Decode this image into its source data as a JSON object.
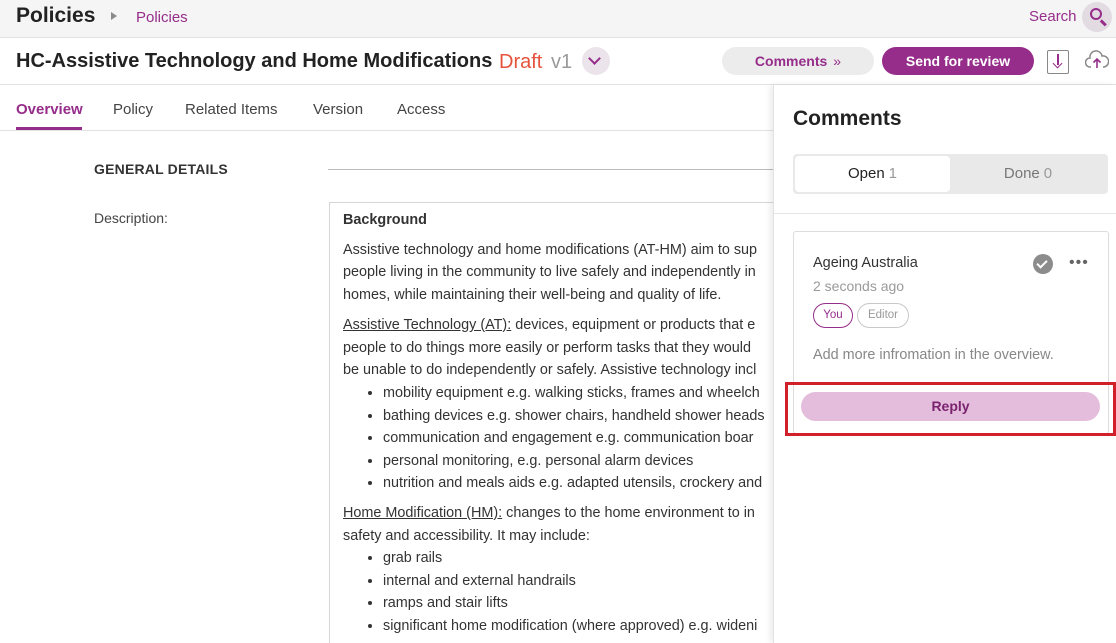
{
  "topbar": {
    "app_title": "Policies",
    "breadcrumb": "Policies",
    "search_label": "Search"
  },
  "header": {
    "doc_title": "HC-Assistive Technology and Home Modifications",
    "status": "Draft",
    "version": "v1",
    "comments_button": "Comments",
    "comments_chevrons": "»",
    "send_button": "Send for review"
  },
  "tabs": [
    "Overview",
    "Policy",
    "Related Items",
    "Version",
    "Access"
  ],
  "general": {
    "section_title": "GENERAL DETAILS",
    "description_label": "Description:"
  },
  "description": {
    "heading": "Background",
    "para1": [
      "Assistive technology and home modifications (AT-HM) aim to sup",
      "people living in the community to live safely and independently in",
      "homes, while maintaining their well-being and quality of life."
    ],
    "at_term": "Assistive Technology (AT):",
    "at_text": [
      " devices, equipment or products that e",
      "people to do things more easily or perform tasks that they would",
      "be unable to do independently or safely. Assistive technology incl"
    ],
    "at_items": [
      "mobility equipment e.g. walking sticks, frames and wheelch",
      "bathing devices e.g. shower chairs, handheld shower heads",
      "communication and engagement e.g. communication boar",
      "personal monitoring, e.g. personal alarm devices",
      "nutrition and meals aids e.g. adapted utensils, crockery and"
    ],
    "hm_term": "Home Modification (HM):",
    "hm_text": [
      " changes to the home environment to in",
      "safety and accessibility. It may include:"
    ],
    "hm_items": [
      "grab rails",
      "internal and external handrails",
      "ramps and stair lifts",
      "significant home modification (where approved) e.g. wideni"
    ]
  },
  "comments_panel": {
    "title": "Comments",
    "open_label": "Open",
    "open_count": "1",
    "done_label": "Done",
    "done_count": "0",
    "comment": {
      "author": "Ageing Australia",
      "time": "2 seconds ago",
      "badge_you": "You",
      "badge_editor": "Editor",
      "text": "Add more infromation in the overview."
    },
    "reply_button": "Reply"
  },
  "colors": {
    "accent": "#962d8a",
    "status_draft": "#e5533c",
    "highlight": "#d1202a"
  },
  "icons": [
    "chevron-right-icon",
    "search-icon",
    "chevron-down-icon",
    "download-icon",
    "upload-icon",
    "check-circle-icon",
    "more-horizontal-icon"
  ]
}
